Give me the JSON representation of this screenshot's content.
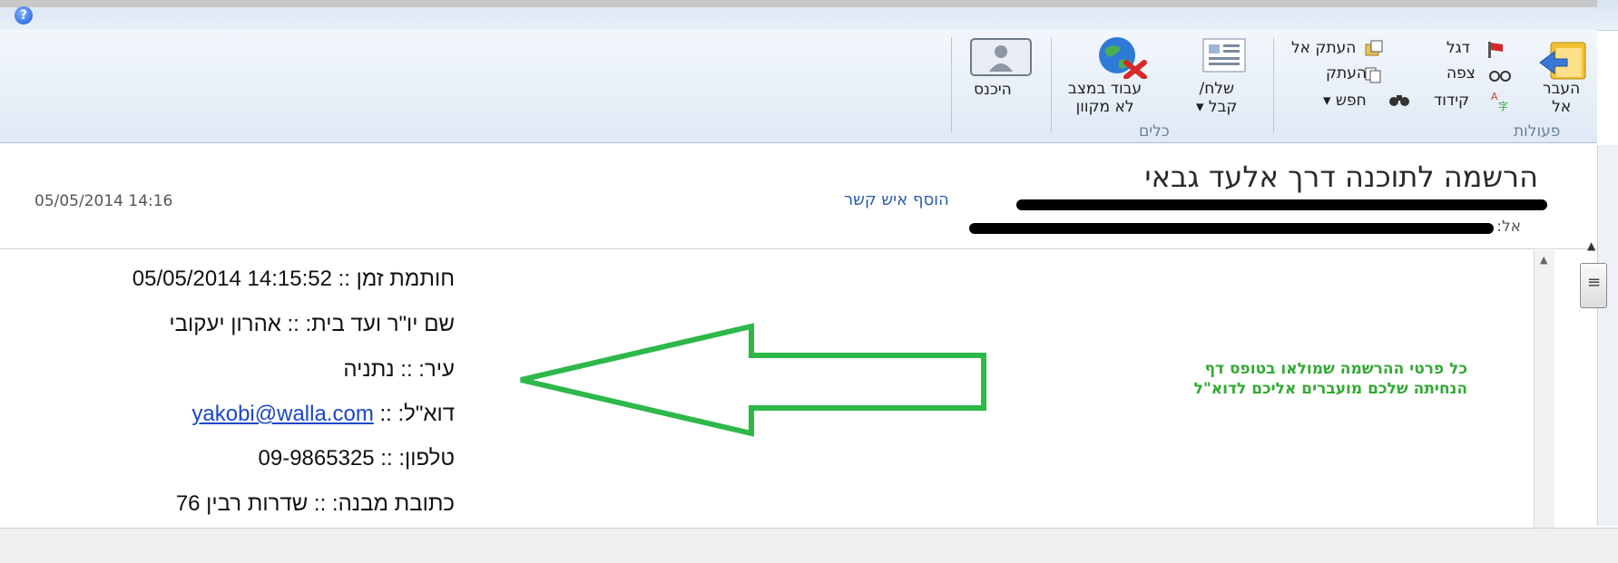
{
  "ribbon": {
    "group_actions_label": "פעולות",
    "group_tools_label": "כלים",
    "move_to_label": [
      "העבר",
      "אל"
    ],
    "flag_label": "דגל",
    "copy_to_label": "העתק אל",
    "watch_label": "צפה",
    "copy_label": "העתק",
    "encoding_label": "קידוד",
    "find_label": "חפש ▾",
    "send_receive_label": [
      "שלח/",
      "קבל ▾"
    ],
    "work_offline_label": [
      "עבוד במצב",
      "לא מקוון"
    ],
    "sign_in_label": "היכנס"
  },
  "message": {
    "subject": "הרשמה לתוכנה דרך אלעד גבאי",
    "to_label": "אל:",
    "add_contact": "הוסף איש קשר",
    "datetime": "05/05/2014 14:16"
  },
  "body": {
    "lines": [
      "חותמת זמן :: 14:15:52 05/05/2014",
      "שם יו\"ר ועד בית: :: אהרון יעקובי",
      "עיר: :: נתניה",
      "דוא\"ל: :: ",
      "טלפון: :: 09-9865325",
      "כתובת מבנה: :: שדרות רבין 76"
    ],
    "email_link": "yakobi@walla.com",
    "note_line1": "כל פרטי ההרשמה שמולאו בטופס דף",
    "note_line2": "הנחיתה שלכם מועברים אליכם לדוא\"ל"
  },
  "colors": {
    "arrow": "#2db84a",
    "link": "#1a47c9",
    "note": "#33aa33"
  }
}
